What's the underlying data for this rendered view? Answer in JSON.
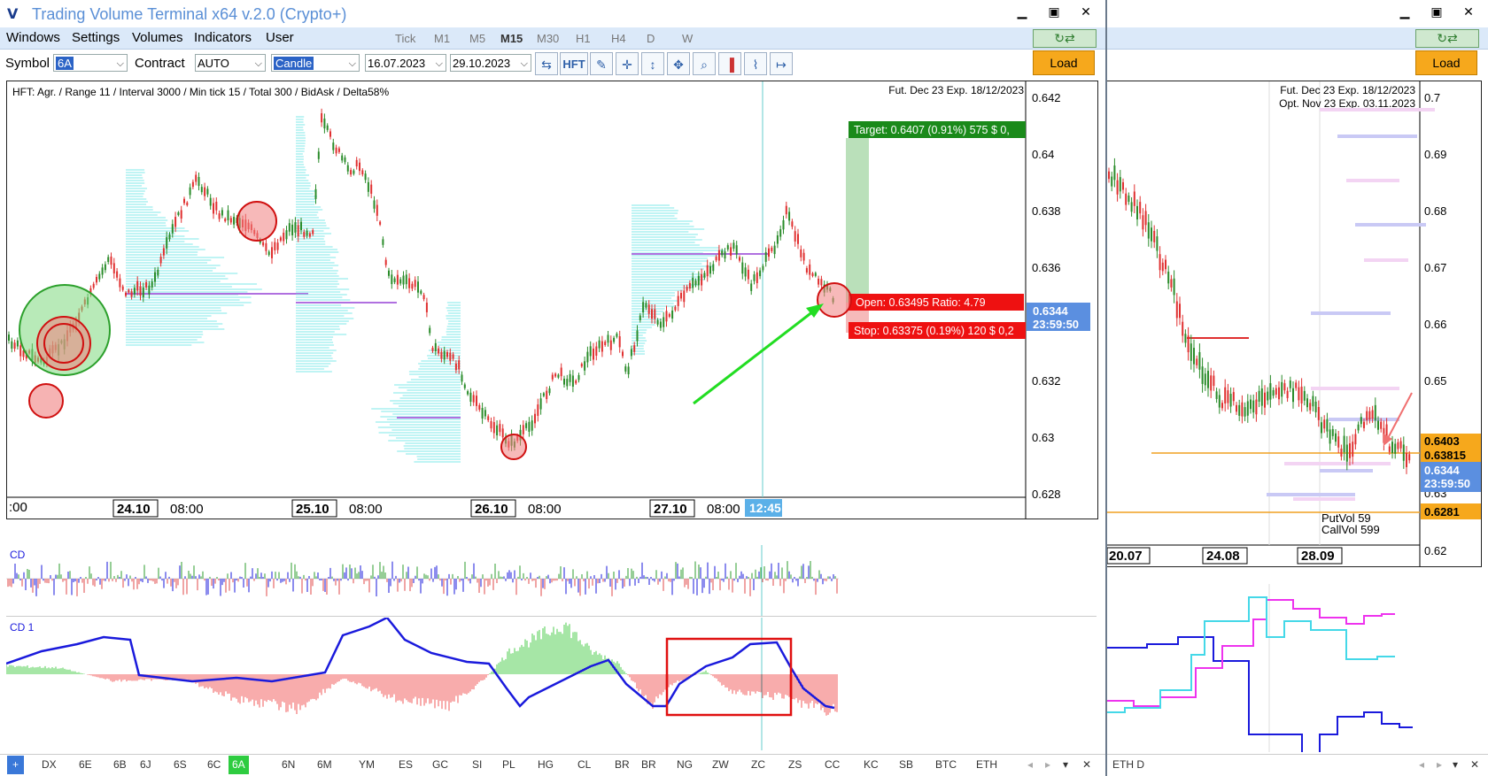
{
  "windowA": {
    "title": "Trading Volume Terminal x64 v.2.0 (Crypto+)",
    "menu": [
      "Windows",
      "Settings",
      "Volumes",
      "Indicators",
      "User"
    ],
    "timeframes": [
      "Tick",
      "M1",
      "M5",
      "M15",
      "M30",
      "H1",
      "H4",
      "D",
      "W"
    ],
    "active_timeframe": "M15",
    "toolbar": {
      "symbol_label": "Symbol",
      "symbol_value": "6A",
      "contract_label": "Contract",
      "contract_value": "AUTO",
      "charttype_value": "Candle",
      "date_from": "16.07.2023",
      "date_to": "29.10.2023",
      "hft_label": "HFT",
      "load_label": "Load"
    },
    "chart": {
      "info": "HFT: Agr. / Range 11 / Interval 3000 / Min tick 15 / Total 300 / BidAsk / Delta58%",
      "contract_info": "Fut. Dec 23 Exp. 18/12/2023",
      "price_ticks": [
        "0.642",
        "0.64",
        "0.638",
        "0.636",
        "0.634",
        "0.632",
        "0.63",
        "0.628"
      ],
      "current_price": "0.6344",
      "countdown": "23:59:50",
      "target_label": "Target: 0.6407 (0.91%) 575 $ 0,",
      "open_label": "Open: 0.63495  Ratio: 4.79",
      "stop_label": "Stop: 0.63375 (0.19%) 120 $ 0,2",
      "time_labels": [
        ":00",
        "24.10",
        "08:00",
        "25.10",
        "08:00",
        "26.10",
        "08:00",
        "27.10",
        "08:00"
      ],
      "crosshair_time": "12:45"
    },
    "cd_label": "CD",
    "cd1_label": "CD 1",
    "tabs": [
      "+",
      "DX",
      "6E",
      "6B",
      "6J",
      "6S",
      "6C",
      "6A",
      "6N",
      "6M",
      "YM",
      "ES",
      "GC",
      "SI",
      "PL",
      "HG",
      "CL",
      "BR",
      "BR",
      "NG",
      "ZW",
      "ZC",
      "ZS",
      "CC",
      "KC",
      "SB",
      "BTC",
      "ETH"
    ],
    "active_tab": "6A",
    "colors": {
      "up": "#2a8c2a",
      "down": "#e03030",
      "profile": "#7fe8e8",
      "poc": "#b070e0",
      "target": "#1a8a1a",
      "stop": "#ee1111",
      "cd_line": "#1a1adc"
    }
  },
  "windowB": {
    "load_label": "Load",
    "contract_info_1": "Fut. Dec 23 Exp. 18/12/2023",
    "contract_info_2": "Opt. Nov 23 Exp. 03.11.2023",
    "price_ticks": [
      "0.7",
      "0.69",
      "0.68",
      "0.67",
      "0.66",
      "0.65",
      "0.63",
      "0.62"
    ],
    "price_tag_1": "0.6403",
    "price_tag_2": "0.63815",
    "current_price": "0.6344",
    "countdown": "23:59:50",
    "price_tag_3": "0.6281",
    "putvol": "PutVol  59",
    "callvol": "CallVol  599",
    "time_labels": [
      "20.07",
      "24.08",
      "28.09"
    ],
    "tab": "ETH D"
  }
}
